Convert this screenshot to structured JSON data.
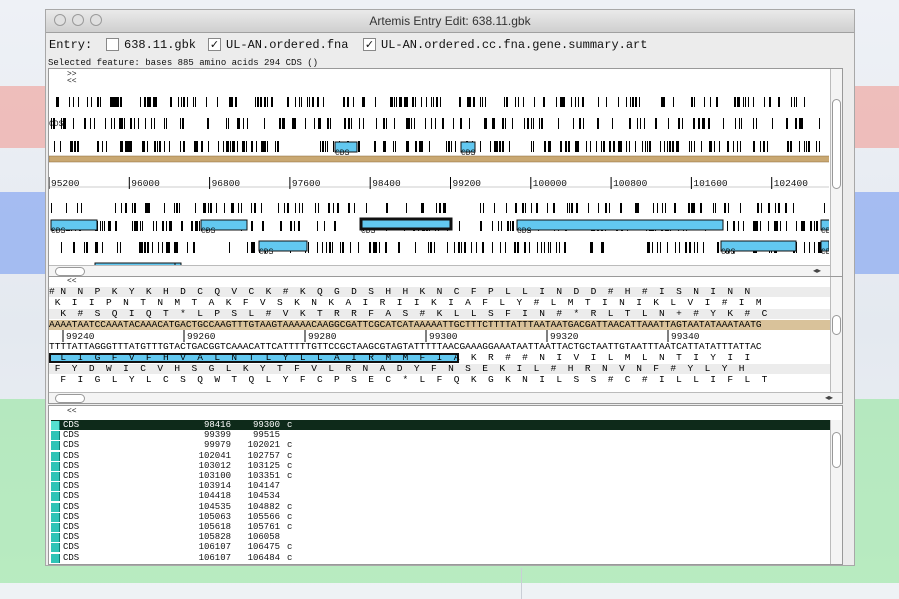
{
  "window": {
    "title": "Artemis Entry Edit: 638.11.gbk"
  },
  "entry": {
    "label": "Entry:",
    "files": [
      {
        "name": "638.11.gbk",
        "checked": false
      },
      {
        "name": "UL-AN.ordered.fna",
        "checked": true
      },
      {
        "name": "UL-AN.ordered.cc.fna.gene.summary.art",
        "checked": true
      }
    ]
  },
  "selected_feature": "Selected feature:  bases 885  amino acids 294  CDS  ()",
  "feature_view": {
    "nav_right": ">>",
    "nav_left": "<<",
    "top_label": "CDS",
    "cds_labels": [
      "CDS",
      "CDS",
      "CDS",
      "CDS",
      "CDS",
      "CDS",
      "CDS",
      "CDS",
      "CDS",
      "CDS",
      "CDS",
      "CDS"
    ],
    "ruler": [
      "95200",
      "96000",
      "96800",
      "97600",
      "98400",
      "99200",
      "100000",
      "100800",
      "101600",
      "102400"
    ]
  },
  "sequence_view": {
    "nav_left": "<<",
    "frame1": "# N  N  P  K  Y  K  H  D  C  Q  V  C  K  #  K  Q  G  D  S  H  H  K  N  C  F  P  L  L  I  N  D  D  #  H  #  I  S  N  I  N  N",
    "frame2": " K  I  I  P  N  T  N  M  T  A  K  F  V  S  K  N  K  A  I  R  I  I  K  I  A  F  L  Y  #  L  M  T  I  N  I  K  L  V  I  #  I  M",
    "frame3": "  K  #  S  Q  I  Q  T  *  L  P  S  L  #  V  K  T  R  R  F  A  S  #  K  L  L  S  F  I  N  #  *  R  L  T  L  N  +  #  Y  K  #  C",
    "dna_fwd": "AAAATAATCCAAATACAAACATGACTGCCAAGTTTGTAAGTAAAAACAAGGCGATTCGCATCATAAAAATTGCTTTCTTTTATTTAATAATGACGATTAACATTAAATTAGTAATATAAATAATG",
    "ruler": [
      "99240",
      "99260",
      "99280",
      "99300",
      "99320",
      "99340"
    ],
    "dna_rev": "TTTTATTAGGGTTTATGTTTGTACTGACGGTCAAACATTCATTTTTGTTCCGCTAAGCGTAGTATTTTTAACGAAAGGAAATAATTAATTACTGCTAATTGTAATTTAATCATTATATTTATTAC",
    "rframe1": "  L  I  G  F  V  F  H  V  A  L  N  T  L  Y  L  L  A  I  R  M  M  F  I  A  K  R  #  #  N  I  V  I  L  M  L  N  T  I  Y  I  I",
    "rframe2": " F  Y  D  W  I  C  V  H  S  G  L  K  Y  T  F  V  L  R  N  A  D  Y  F  N  S  E  K  I  L  #  H  R  N  V  N  F  #  Y  L  Y  H",
    "rframe3": "  F  I  G  L  Y  L  C  S  Q  W  T  Q  L  Y  F  C  P  S  E  C  *  L  F  Q  K  G  K  N  I  L  S  S  #  C  #  I  L  L  I  F  L  T"
  },
  "feature_list": {
    "nav_left": "<<",
    "rows": [
      {
        "key": "CDS",
        "start": "98416",
        "end": "99300",
        "comp": "c"
      },
      {
        "key": "CDS",
        "start": "99399",
        "end": "99515",
        "comp": ""
      },
      {
        "key": "CDS",
        "start": "99979",
        "end": "102021",
        "comp": "c"
      },
      {
        "key": "CDS",
        "start": "102041",
        "end": "102757",
        "comp": "c"
      },
      {
        "key": "CDS",
        "start": "103012",
        "end": "103125",
        "comp": "c"
      },
      {
        "key": "CDS",
        "start": "103100",
        "end": "103351",
        "comp": "c"
      },
      {
        "key": "CDS",
        "start": "103914",
        "end": "104147",
        "comp": ""
      },
      {
        "key": "CDS",
        "start": "104418",
        "end": "104534",
        "comp": ""
      },
      {
        "key": "CDS",
        "start": "104535",
        "end": "104882",
        "comp": "c"
      },
      {
        "key": "CDS",
        "start": "105063",
        "end": "105566",
        "comp": "c"
      },
      {
        "key": "CDS",
        "start": "105618",
        "end": "105761",
        "comp": "c"
      },
      {
        "key": "CDS",
        "start": "105828",
        "end": "106058",
        "comp": ""
      },
      {
        "key": "CDS",
        "start": "106107",
        "end": "106475",
        "comp": "c"
      },
      {
        "key": "CDS",
        "start": "106107",
        "end": "106484",
        "comp": "c"
      }
    ]
  },
  "colors": {
    "cds_fill": "#62c8f0",
    "feature_swatch": "#2ec4b6",
    "selection": "#0e2a1a",
    "band_red": "#f0968c",
    "band_blue": "#6e96f0",
    "band_green": "#8ce696"
  }
}
